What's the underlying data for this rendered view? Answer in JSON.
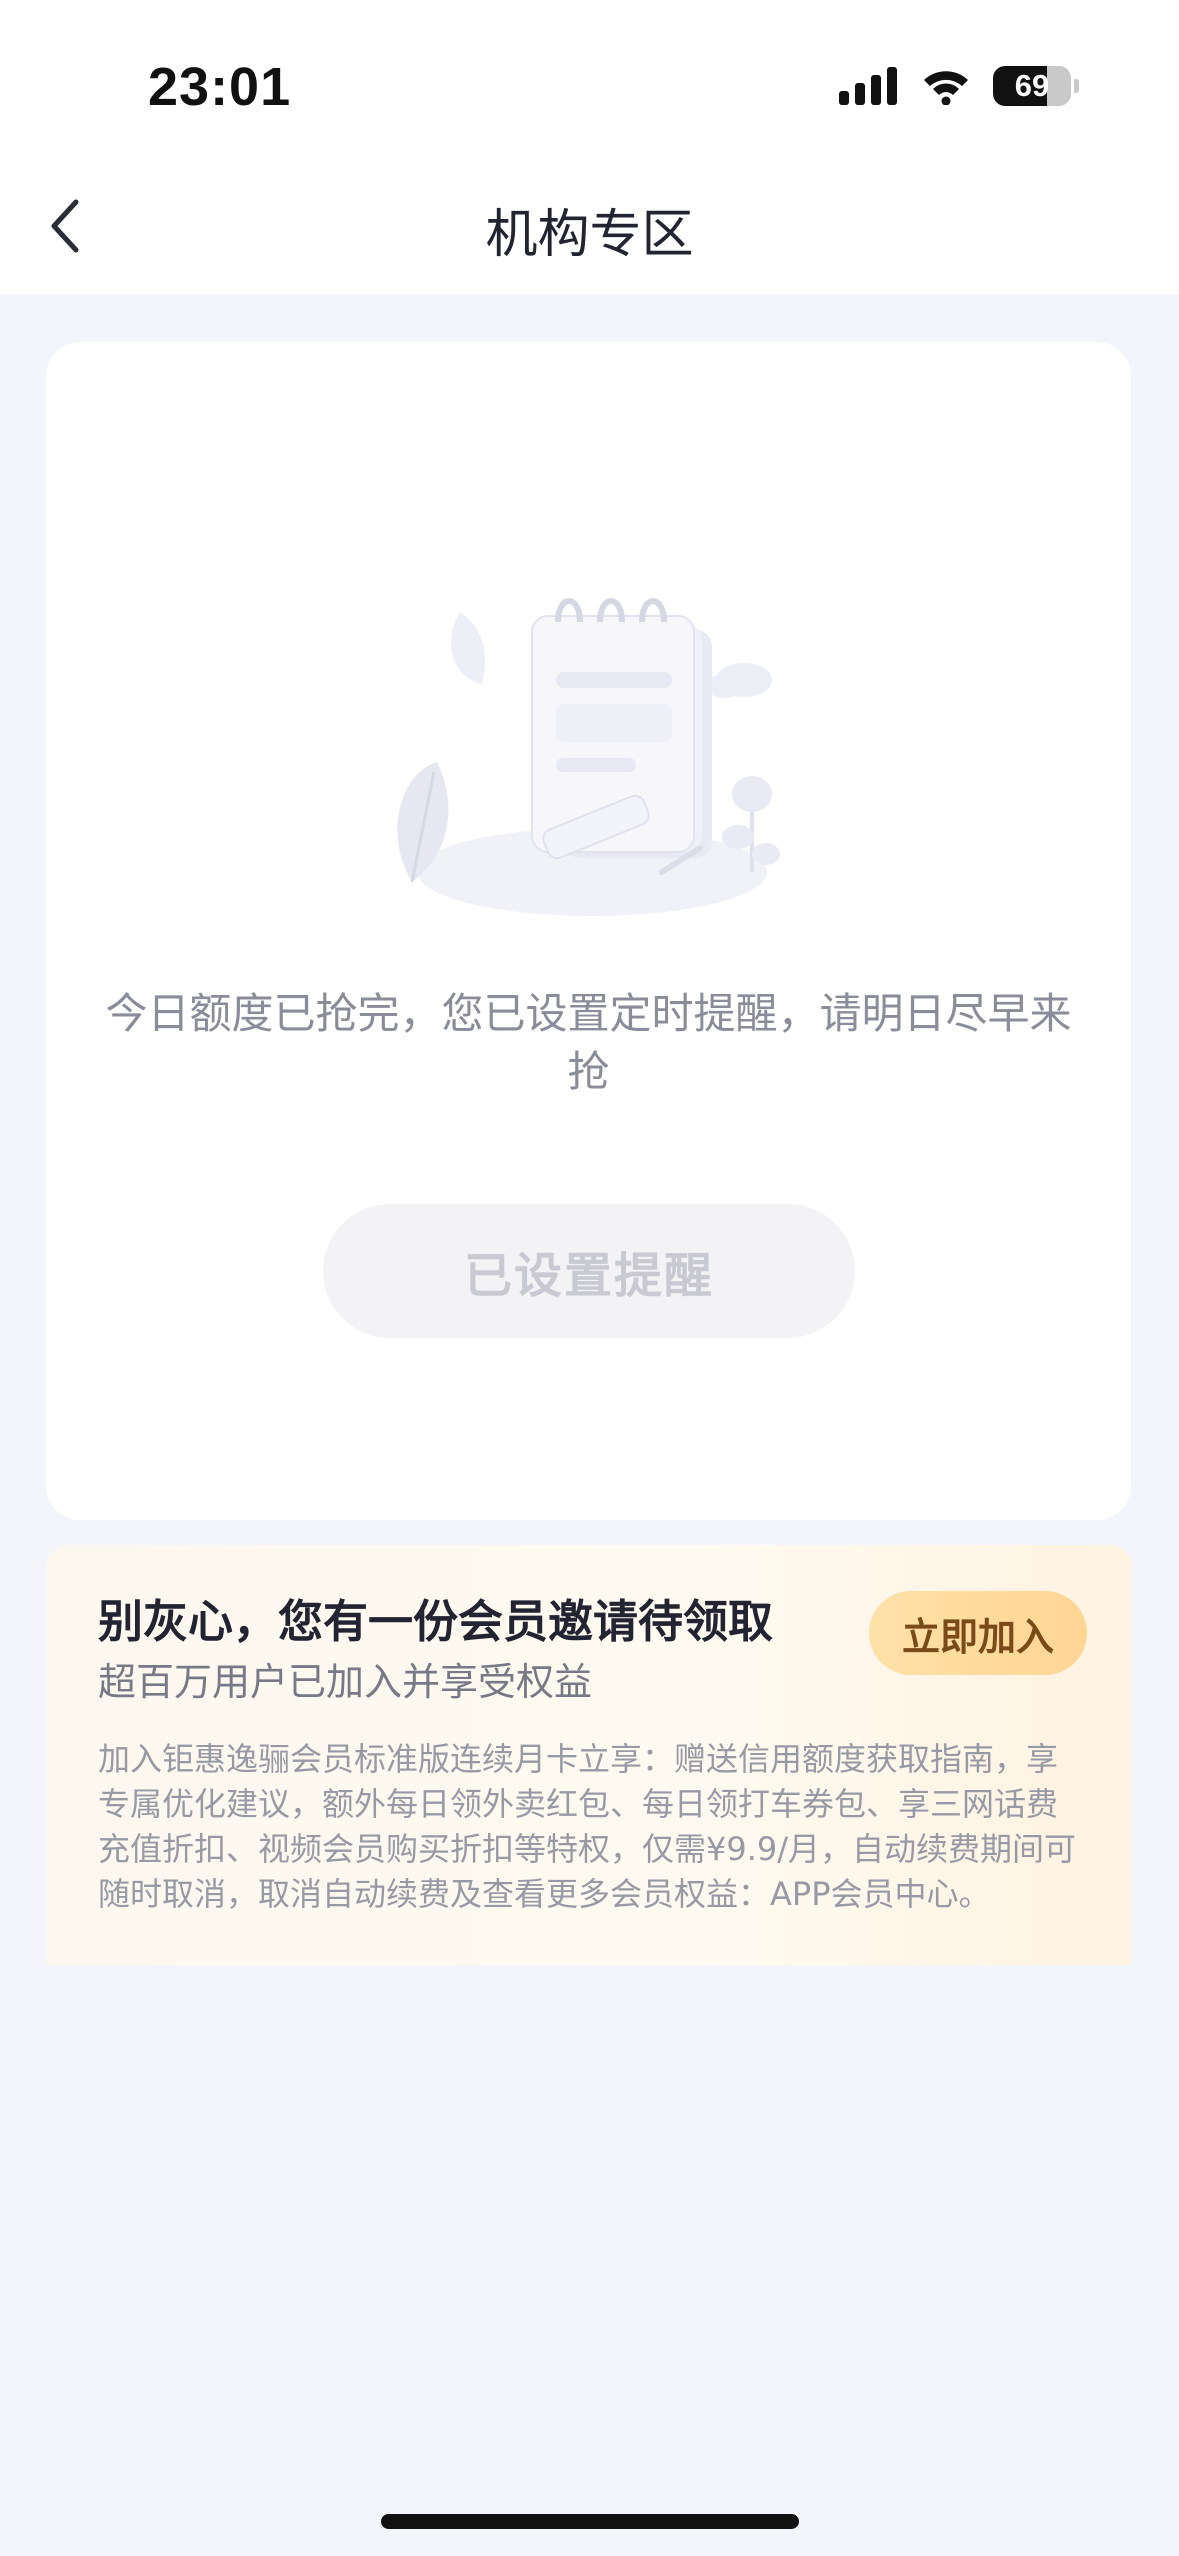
{
  "status_bar": {
    "time": "23:01",
    "battery_level": "69",
    "battery_fraction": 0.69,
    "icons": [
      "cellular-signal-icon",
      "wifi-icon",
      "battery-icon"
    ]
  },
  "nav": {
    "title": "机构专区",
    "back_icon": "chevron-left-icon"
  },
  "empty_state": {
    "illustration": "empty-notebook-illustration",
    "message": "今日额度已抢完，您已设置定时提醒，请明日尽早来抢",
    "button_label": "已设置提醒"
  },
  "vip": {
    "title": "别灰心，您有一份会员邀请待领取",
    "subtitle": "超百万用户已加入并享受权益",
    "join_label": "立即加入",
    "description": "加入钜惠逸骊会员标准版连续月卡立享：赠送信用额度获取指南，享专属优化建议，额外每日领外卖红包、每日领打车券包、享三网话费充值折扣、视频会员购买折扣等特权，仅需¥9.9/月，自动续费期间可随时取消，取消自动续费及查看更多会员权益：APP会员中心。"
  },
  "colors": {
    "page_bg": "#f4f5fa",
    "title_text": "#222431",
    "muted_text": "#8a8c99",
    "disabled_button_bg": "#f3f3f6",
    "disabled_button_text": "#c9cad1",
    "join_button_bg": "#ffd99c",
    "join_button_text": "#7a4a18"
  }
}
